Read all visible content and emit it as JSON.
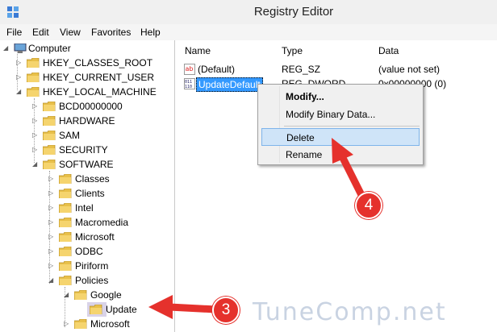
{
  "window": {
    "title": "Registry Editor"
  },
  "menu": [
    "File",
    "Edit",
    "View",
    "Favorites",
    "Help"
  ],
  "tree": {
    "root": "Computer",
    "nodes": [
      {
        "label": "HKEY_CLASSES_ROOT"
      },
      {
        "label": "HKEY_CURRENT_USER"
      },
      {
        "label": "HKEY_LOCAL_MACHINE"
      },
      {
        "label": "BCD00000000"
      },
      {
        "label": "HARDWARE"
      },
      {
        "label": "SAM"
      },
      {
        "label": "SECURITY"
      },
      {
        "label": "SOFTWARE"
      },
      {
        "label": "Classes"
      },
      {
        "label": "Clients"
      },
      {
        "label": "Intel"
      },
      {
        "label": "Macromedia"
      },
      {
        "label": "Microsoft"
      },
      {
        "label": "ODBC"
      },
      {
        "label": "Piriform"
      },
      {
        "label": "Policies"
      },
      {
        "label": "Google"
      },
      {
        "label": "Update"
      },
      {
        "label": "Microsoft"
      }
    ]
  },
  "list": {
    "headers": {
      "name": "Name",
      "type": "Type",
      "data": "Data"
    },
    "rows": [
      {
        "name": "(Default)",
        "type": "REG_SZ",
        "data": "(value not set)",
        "icon": "string-value-icon"
      },
      {
        "name": "UpdateDefault",
        "type": "REG_DWORD",
        "data": "0x00000000 (0)",
        "icon": "binary-value-icon"
      }
    ]
  },
  "context_menu": {
    "modify": "Modify...",
    "modify_binary": "Modify Binary Data...",
    "delete": "Delete",
    "rename": "Rename"
  },
  "annotations": {
    "step3": "3",
    "step4": "4"
  },
  "watermark": "TuneComp.net",
  "colors": {
    "selection": "#d9d3e8",
    "highlight": "#cfe4f8",
    "arrow": "#e5312c"
  }
}
